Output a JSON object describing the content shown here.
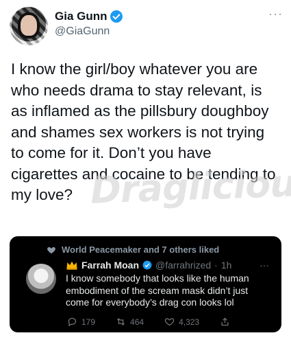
{
  "tweet": {
    "author": {
      "name": "Gia Gunn",
      "handle": "@GiaGunn",
      "verified": true
    },
    "text": "I know the girl/boy whatever you are who needs drama to stay relevant, is as inflamed as the pillsbury doughboy and shames sex workers is not trying to come for it.  Don’t you have cigarettes and cocaine to be tending to my love?",
    "more_icon": "more-icon"
  },
  "watermark": {
    "part1": "Drag",
    "part2": "licious"
  },
  "quoted": {
    "liked_by": "World Peacemaker and 7 others liked",
    "author": {
      "emoji": "👑",
      "name": "Farrah Moan",
      "handle": "@farrahrized",
      "time": "1h",
      "verified": true
    },
    "text": "I know somebody that looks like the human embodiment of the scream mask didn’t just come for everybody’s drag con looks lol",
    "stats": {
      "replies": "179",
      "retweets": "464",
      "likes": "4,323"
    }
  },
  "colors": {
    "accent": "#1d9bf0",
    "card_bg": "#000000",
    "muted": "#536471"
  }
}
